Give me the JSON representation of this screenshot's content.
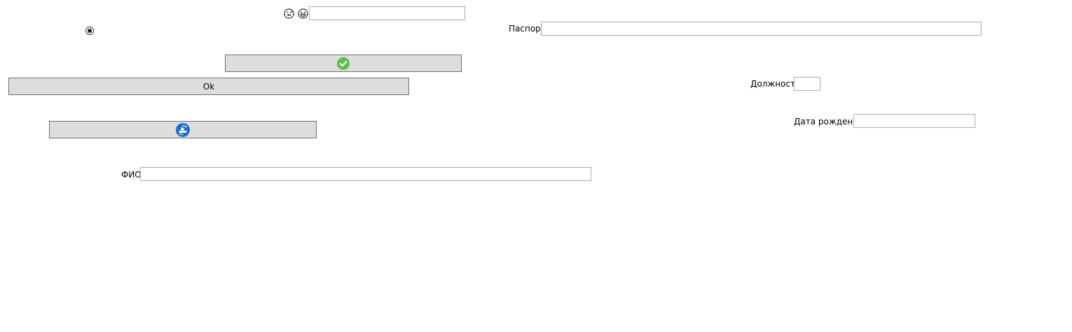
{
  "form": {
    "passport_label": "Паспорт",
    "passport_value": "",
    "position_label": "Должность",
    "position_value": "",
    "birthdate_label": "Дата рождения",
    "birthdate_value": "",
    "fio_label": "ФИО",
    "fio_value": "",
    "emoji_field_value": "",
    "radio_selected": true
  },
  "buttons": {
    "ok_label": "Ok"
  },
  "icons": {
    "emoji_1": "grinning-sweat-face-icon",
    "emoji_2": "grinning-face-icon",
    "confirm": "green-check-circle-icon",
    "rotate": "blue-ship-rotate-icon"
  },
  "colors": {
    "button_bg": "#dddddd",
    "button_border": "#707070",
    "input_border": "#ababab",
    "check_green": "#5cbf4a",
    "icon_blue": "#1a6fc9"
  }
}
